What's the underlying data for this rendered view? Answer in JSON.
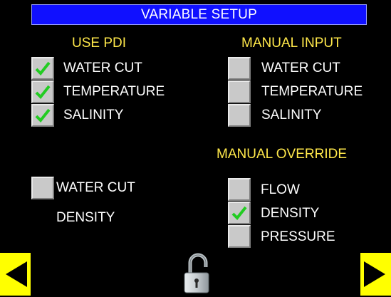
{
  "title": "VARIABLE SETUP",
  "use_pdi": {
    "heading": "USE PDI",
    "items": [
      {
        "label": "WATER CUT",
        "checked": true
      },
      {
        "label": "TEMPERATURE",
        "checked": true
      },
      {
        "label": "SALINITY",
        "checked": true
      }
    ]
  },
  "manual_input": {
    "heading": "MANUAL INPUT",
    "items": [
      {
        "label": "WATER CUT",
        "checked": false
      },
      {
        "label": "TEMPERATURE",
        "checked": false
      },
      {
        "label": "SALINITY",
        "checked": false
      }
    ]
  },
  "left_lower": {
    "water_cut_label": "WATER CUT",
    "water_cut_checked": false,
    "density_label": "DENSITY"
  },
  "manual_override": {
    "heading": "MANUAL OVERRIDE",
    "items": [
      {
        "label": "FLOW",
        "checked": false
      },
      {
        "label": "DENSITY",
        "checked": true
      },
      {
        "label": "PRESSURE",
        "checked": false
      }
    ]
  },
  "nav": {
    "prev_icon": "left-arrow-icon",
    "next_icon": "right-arrow-icon",
    "lock_icon": "unlocked-padlock-icon"
  },
  "colors": {
    "background": "#000000",
    "title_bar": "#1010ff",
    "heading": "#ffe84a",
    "text": "#ffffff",
    "check": "#22cc22",
    "nav_button": "#ffff00"
  }
}
